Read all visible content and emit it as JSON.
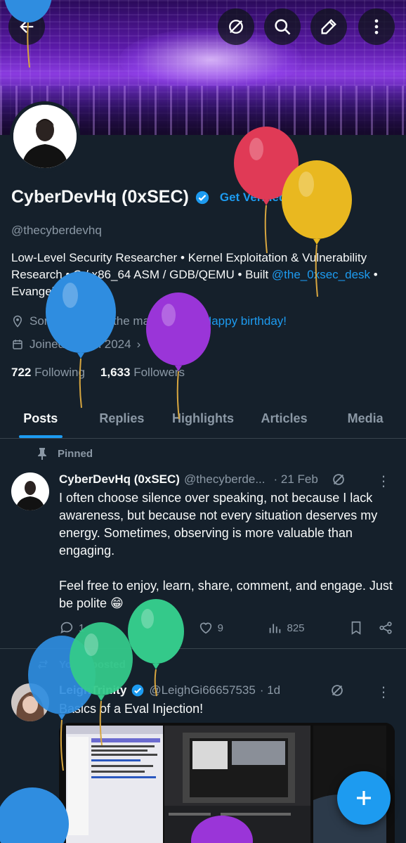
{
  "header": {
    "back_icon": "arrow-left-icon",
    "actions": [
      "grok-icon",
      "search-icon",
      "edit-icon",
      "more-vertical-icon"
    ]
  },
  "profile": {
    "display_name": "CyberDevHq (0xSEC)",
    "get_verified": "Get Verified",
    "handle": "@thecyberdevhq",
    "bio_part1": "Low-Level Security Researcher • Kernel Exploitation & Vulnerability Research • C / x86_64 ASM / GDB/QEMU • Built ",
    "bio_link": "@the_0xsec_desk",
    "bio_part2": " • Evangelist",
    "location": "Somewhere on the map 😎",
    "birthday": "Happy birthday!",
    "joined": "Joined March 2024",
    "following_count": "722",
    "following_label": "Following",
    "followers_count": "1,633",
    "followers_label": "Followers"
  },
  "tabs": [
    "Posts",
    "Replies",
    "Highlights",
    "Articles",
    "Media"
  ],
  "pinned_tweet": {
    "pinned_label": "Pinned",
    "name": "CyberDevHq (0xSEC)",
    "handle": "@thecyberde...",
    "date": "· 21 Feb",
    "text_p1": "I often choose silence over speaking, not because I lack awareness, but because not every situation deserves my energy. Sometimes, observing is more valuable than engaging.",
    "text_p2": "Feel free to enjoy, learn, share, comment, and engage. Just be polite 😁",
    "replies": "1",
    "reposts": "2",
    "likes": "9",
    "views": "825"
  },
  "repost_tweet": {
    "repost_label": "You reposted",
    "name": "LeighTrinity",
    "handle": "@LeighGi66657535",
    "date": "· 1d",
    "text": "Basics of a Eval Injection!"
  },
  "colors": {
    "background": "#15202b",
    "accent": "#1d9bf0",
    "muted": "#8b98a5"
  }
}
